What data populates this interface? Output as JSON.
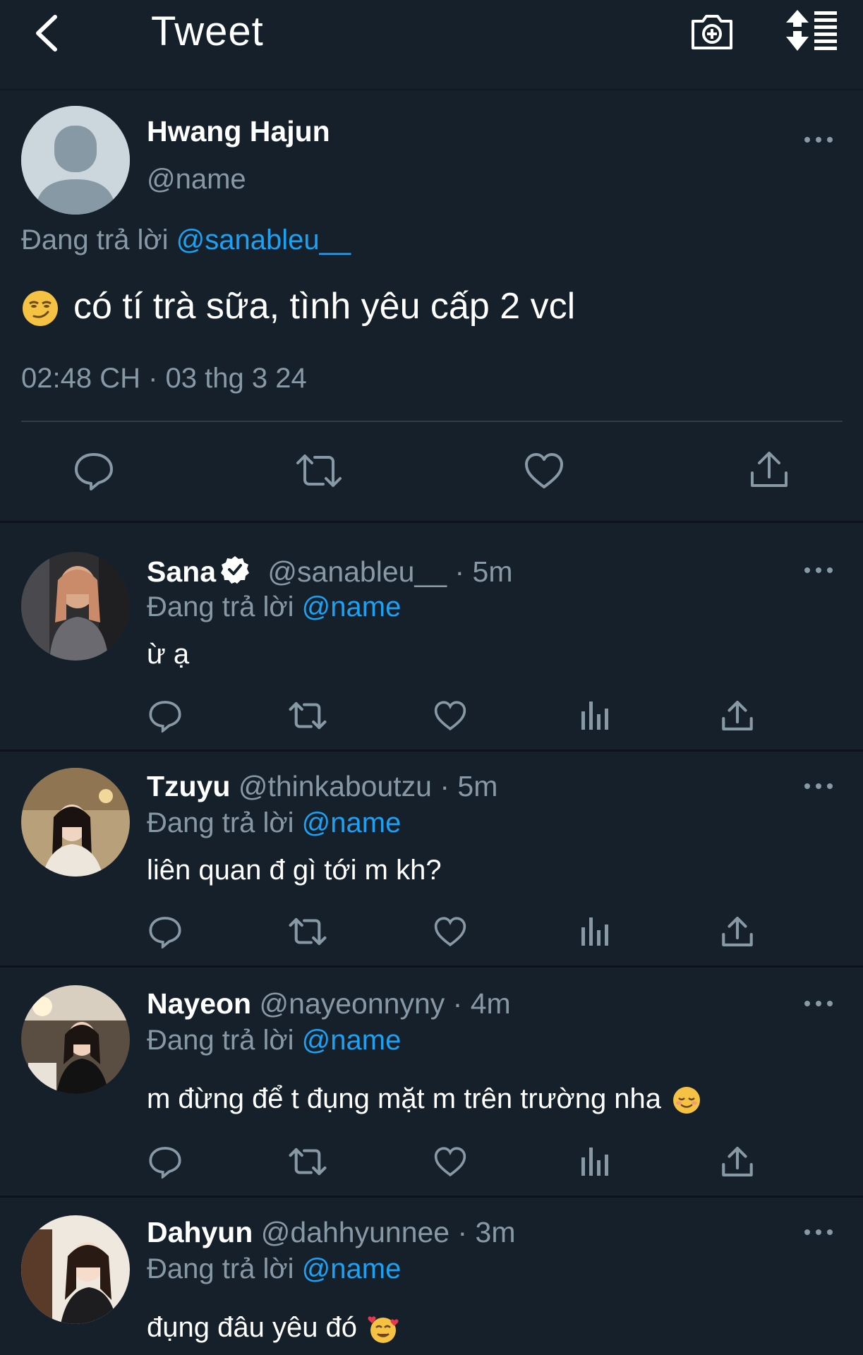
{
  "header": {
    "title": "Tweet",
    "back_icon": "chevron-left-icon",
    "camera_icon": "camera-add-icon",
    "sort_icon": "sort-list-icon"
  },
  "main_tweet": {
    "name": "Hwang Hajun",
    "handle": "@name",
    "replying_prefix": "Đang trả lời",
    "replying_to": "@sanableu__",
    "emoji": "smirking-face",
    "text": "có tí trà sữa, tình yêu cấp 2 vcl",
    "timestamp": "02:48 CH · 03 thg 3 24"
  },
  "replies": [
    {
      "name": "Sana",
      "verified": true,
      "handle": "@sanableu__",
      "time": "· 5m",
      "replying_prefix": "Đang trả lời",
      "replying_to": "@name",
      "text": "ừ ạ",
      "avatar_color": "#3a3a3a"
    },
    {
      "name": "Tzuyu",
      "verified": false,
      "handle": "@thinkaboutzu",
      "time": "· 5m",
      "replying_prefix": "Đang trả lời",
      "replying_to": "@name",
      "text": "liên quan đ gì tới m kh?",
      "avatar_color": "#b59a6c"
    },
    {
      "name": "Nayeon",
      "verified": false,
      "handle": "@nayeonnyny",
      "time": "· 4m",
      "replying_prefix": "Đang trả lời",
      "replying_to": "@name",
      "text": "m đừng để t đụng mặt m trên trường nha",
      "emoji": "relieved-face",
      "avatar_color": "#4a4038"
    },
    {
      "name": "Dahyun",
      "verified": false,
      "handle": "@dahhyunnee",
      "time": "· 3m",
      "replying_prefix": "Đang trả lời",
      "replying_to": "@name",
      "text": "đụng đâu yêu đó",
      "emoji": "smiling-face-with-hearts",
      "avatar_color": "#6b5a4a"
    }
  ],
  "colors": {
    "background": "#15202b",
    "link": "#1da1f2",
    "muted": "#8899a6",
    "divider": "#2f3b47"
  }
}
